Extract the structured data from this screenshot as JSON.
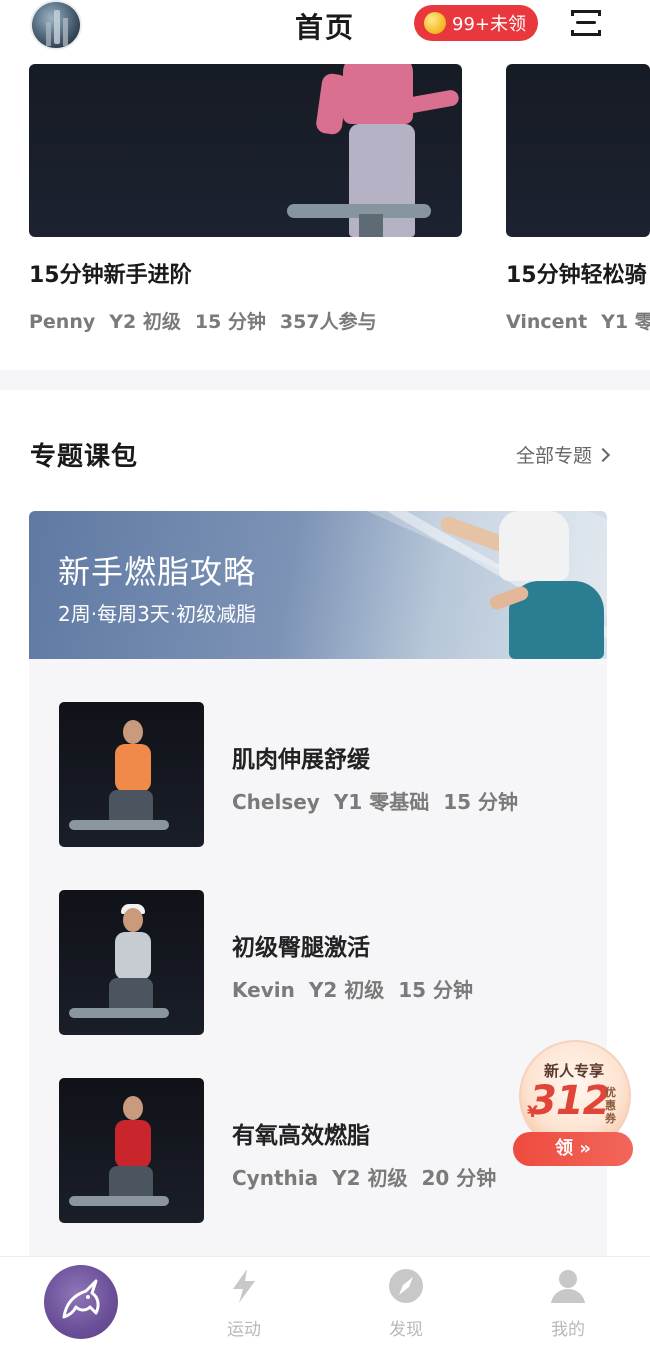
{
  "header": {
    "title": "首页",
    "coins_label": "99+未领",
    "menu_icon": "menu-icon"
  },
  "carousel": [
    {
      "title": "15分钟新手进阶",
      "coach": "Penny",
      "level": "Y2 初级",
      "duration": "15 分钟",
      "participants": "357人参与"
    },
    {
      "title": "15分钟轻松骑",
      "coach": "Vincent",
      "level": "Y1 零"
    }
  ],
  "section": {
    "title": "专题课包",
    "more_label": "全部专题"
  },
  "pack": {
    "banner_title": "新手燃脂攻略",
    "banner_sub": "2周·每周3天·初级减脂",
    "lessons": [
      {
        "title": "肌肉伸展舒缓",
        "coach": "Chelsey",
        "level": "Y1 零基础",
        "duration": "15 分钟",
        "shirt_color": "#f08a4b"
      },
      {
        "title": "初级臀腿激活",
        "coach": "Kevin",
        "level": "Y2 初级",
        "duration": "15 分钟",
        "shirt_color": "#c7ccd2"
      },
      {
        "title": "有氧高效燃脂",
        "coach": "Cynthia",
        "level": "Y2 初级",
        "duration": "20 分钟",
        "shirt_color": "#c8262c"
      }
    ]
  },
  "coupon": {
    "top": "新人专享",
    "currency": "¥",
    "amount": "312",
    "side": "优惠券",
    "button": "领 »"
  },
  "tabbar": {
    "items": [
      {
        "label": "",
        "icon": "unicorn-logo-icon"
      },
      {
        "label": "运动",
        "icon": "lightning-icon"
      },
      {
        "label": "发现",
        "icon": "compass-icon"
      },
      {
        "label": "我的",
        "icon": "user-icon"
      }
    ]
  },
  "colors": {
    "accent_red": "#e8383d",
    "brand_purple": "#6a4f98",
    "muted_text": "#7a7a7a"
  }
}
